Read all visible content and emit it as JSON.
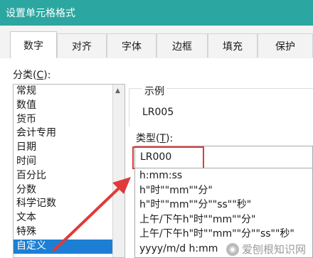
{
  "window": {
    "title": "设置单元格格式"
  },
  "tabs": [
    {
      "label": "数字",
      "active": true
    },
    {
      "label": "对齐"
    },
    {
      "label": "字体"
    },
    {
      "label": "边框"
    },
    {
      "label": "填充"
    },
    {
      "label": "保护"
    }
  ],
  "category": {
    "label_prefix": "分类(",
    "label_key": "C",
    "label_suffix": "):",
    "items": [
      "常规",
      "数值",
      "货币",
      "会计专用",
      "日期",
      "时间",
      "百分比",
      "分数",
      "科学记数",
      "文本",
      "特殊",
      "自定义"
    ],
    "selected_index": 11
  },
  "sample": {
    "label": "示例",
    "value": "LR005"
  },
  "type": {
    "label_prefix": "类型(",
    "label_key": "T",
    "label_suffix": "):",
    "value": "LR000",
    "list": [
      "h:mm:ss",
      "h\"时\"\"mm\"\"分\"",
      "h\"时\"\"mm\"\"分\"\"ss\"\"秒\"",
      "上午/下午h\"时\"\"mm\"\"分\"",
      "上午/下午h\"时\"\"mm\"\"分\"\"ss\"\"秒\"",
      "yyyy/m/d h:mm"
    ]
  },
  "watermark": {
    "text": "爱刨根知识网"
  },
  "colors": {
    "titlebar": "#2ca6a0",
    "selection": "#1d7fd4",
    "annotation": "#e03a3a"
  }
}
